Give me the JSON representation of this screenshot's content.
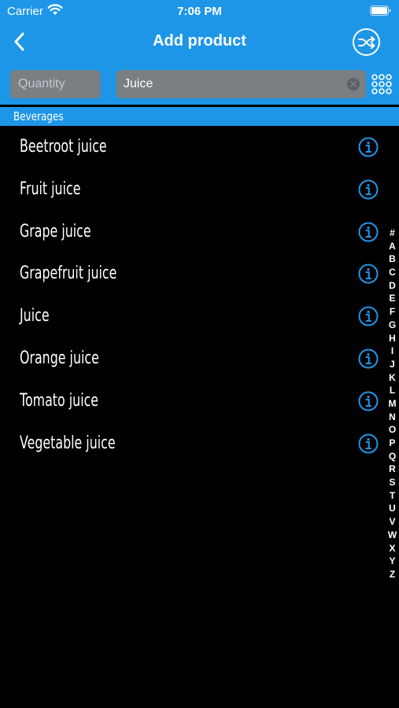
{
  "status_bar": {
    "carrier": "Carrier",
    "time": "7:06 PM"
  },
  "nav": {
    "title": "Add product",
    "back_icon": "chevron-left-icon",
    "action_icon": "shuffle-icon"
  },
  "search": {
    "quantity_placeholder": "Quantity",
    "query": "Juice"
  },
  "section": {
    "title": "Beverages"
  },
  "products": [
    {
      "label": "Beetroot juice"
    },
    {
      "label": "Fruit juice"
    },
    {
      "label": "Grape juice"
    },
    {
      "label": "Grapefruit juice"
    },
    {
      "label": "Juice"
    },
    {
      "label": "Orange juice"
    },
    {
      "label": "Tomato juice"
    },
    {
      "label": "Vegetable juice"
    }
  ],
  "index_letters": [
    "#",
    "A",
    "B",
    "C",
    "D",
    "E",
    "F",
    "G",
    "H",
    "I",
    "J",
    "K",
    "L",
    "M",
    "N",
    "O",
    "P",
    "Q",
    "R",
    "S",
    "T",
    "U",
    "V",
    "W",
    "X",
    "Y",
    "Z"
  ],
  "colors": {
    "accent": "#1e96e8",
    "background": "#000000",
    "field": "#7a7f84"
  }
}
